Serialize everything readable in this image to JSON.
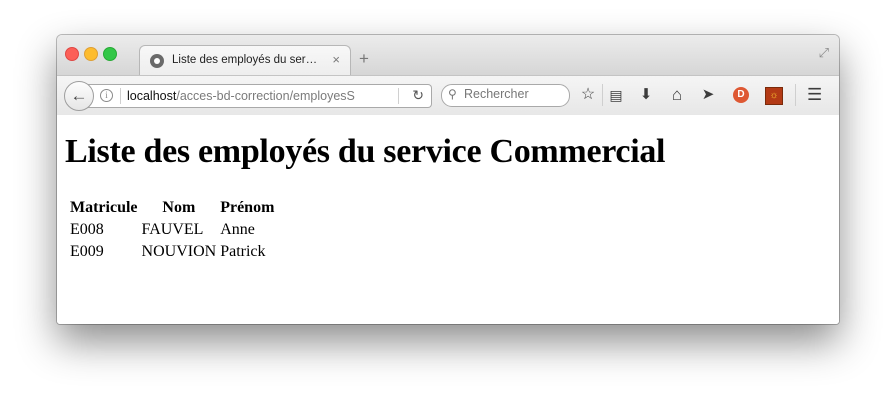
{
  "browser": {
    "tab_title": "Liste des employés du ser…",
    "tab_close": "×",
    "new_tab": "+",
    "url_host": "localhost",
    "url_path": "/acces-bd-correction/employesS",
    "search_placeholder": "Rechercher",
    "icons": [
      "back-arrow-icon",
      "info-icon",
      "reload-icon",
      "search-icon",
      "bookmark-star-icon",
      "reading-list-icon",
      "download-icon",
      "home-icon",
      "send-icon",
      "duckduckgo-icon",
      "extension-icon",
      "menu-icon"
    ]
  },
  "page": {
    "heading": "Liste des employés du service Commercial",
    "table": {
      "headers": [
        "Matricule",
        "Nom",
        "Prénom"
      ],
      "rows": [
        [
          "E008",
          "FAUVEL",
          "Anne"
        ],
        [
          "E009",
          "NOUVION",
          "Patrick"
        ]
      ]
    }
  }
}
